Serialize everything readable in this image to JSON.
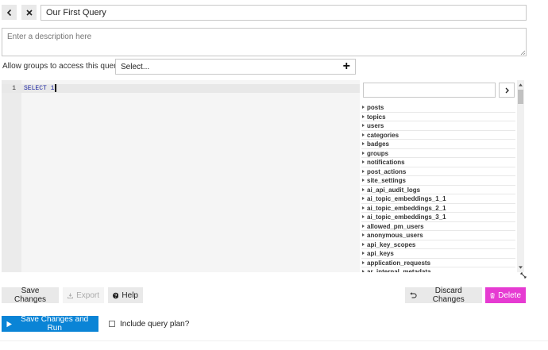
{
  "header": {
    "back_icon": "chevron-left-icon",
    "close_icon": "close-icon",
    "query_name": "Our First Query"
  },
  "description": {
    "placeholder": "Enter a description here",
    "value": ""
  },
  "groups": {
    "label": "Allow groups to access this query",
    "select_value": "Select...",
    "add_icon": "plus-icon"
  },
  "editor": {
    "line_number": "1",
    "code": "SELECT 1"
  },
  "schema": {
    "search_value": "",
    "go_icon": "chevron-right-icon",
    "tables": [
      "posts",
      "topics",
      "users",
      "categories",
      "badges",
      "groups",
      "notifications",
      "post_actions",
      "site_settings",
      "ai_api_audit_logs",
      "ai_topic_embeddings_1_1",
      "ai_topic_embeddings_2_1",
      "ai_topic_embeddings_3_1",
      "allowed_pm_users",
      "anonymous_users",
      "api_key_scopes",
      "api_keys",
      "application_requests",
      "ar_internal_metadata"
    ]
  },
  "actions": {
    "save_changes": "Save Changes",
    "export": "Export",
    "help": "Help",
    "discard_changes": "Discard Changes",
    "delete": "Delete",
    "save_and_run": "Save Changes and Run",
    "include_query_plan": "Include query plan?"
  },
  "colors": {
    "primary": "#0a84d6",
    "delete": "#e63bd2",
    "button_gray": "#e9e9e9"
  }
}
